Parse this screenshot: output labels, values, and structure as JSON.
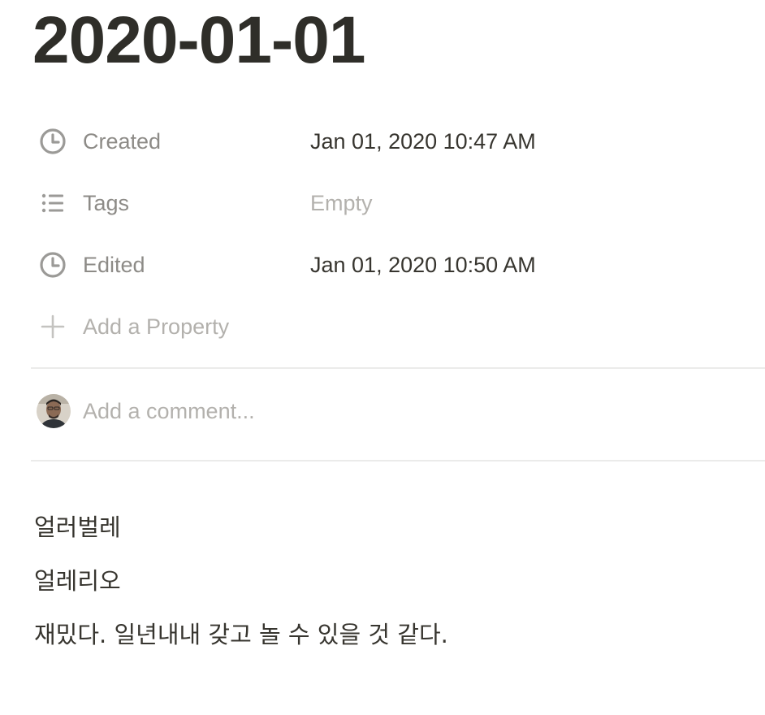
{
  "page": {
    "title": "2020-01-01"
  },
  "properties": [
    {
      "icon": "clock-icon",
      "name": "Created",
      "value": "Jan 01, 2020 10:47 AM",
      "empty": false
    },
    {
      "icon": "list-icon",
      "name": "Tags",
      "value": "Empty",
      "empty": true
    },
    {
      "icon": "clock-icon",
      "name": "Edited",
      "value": "Jan 01, 2020 10:50 AM",
      "empty": false
    }
  ],
  "add_property": {
    "icon": "plus-icon",
    "label": "Add a Property"
  },
  "comment": {
    "avatar": "user-avatar",
    "placeholder": "Add a comment..."
  },
  "content": {
    "paragraphs": [
      "얼러벌레",
      "얼레리오",
      "재밌다. 일년내내 갖고 놀 수 있을 것 같다."
    ]
  },
  "colors": {
    "text_primary": "#37352f",
    "text_secondary": "#8d8b87",
    "text_placeholder": "#b3b1ad",
    "divider": "#ebebea"
  }
}
